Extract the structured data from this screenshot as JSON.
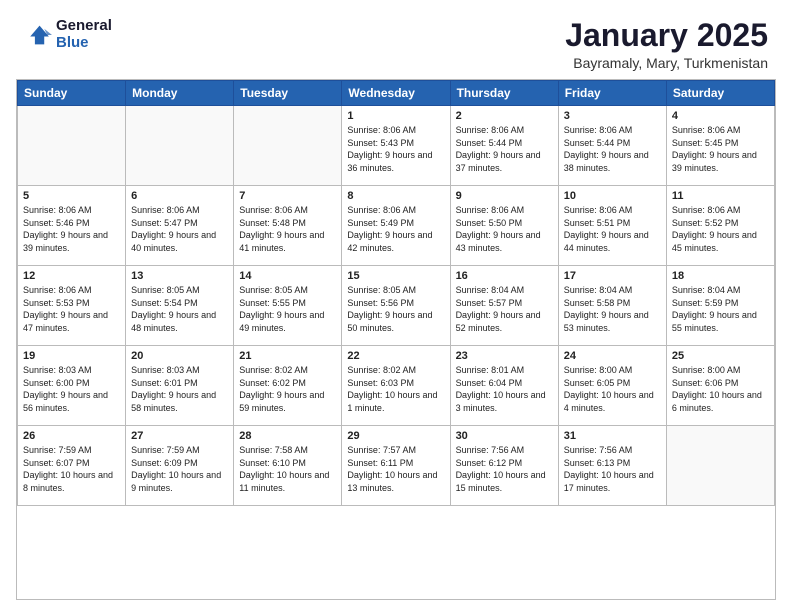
{
  "logo": {
    "general": "General",
    "blue": "Blue"
  },
  "title": "January 2025",
  "subtitle": "Bayramaly, Mary, Turkmenistan",
  "headers": [
    "Sunday",
    "Monday",
    "Tuesday",
    "Wednesday",
    "Thursday",
    "Friday",
    "Saturday"
  ],
  "weeks": [
    [
      {
        "day": "",
        "empty": true
      },
      {
        "day": "",
        "empty": true
      },
      {
        "day": "",
        "empty": true
      },
      {
        "day": "1",
        "sunrise": "8:06 AM",
        "sunset": "5:43 PM",
        "daylight": "9 hours and 36 minutes."
      },
      {
        "day": "2",
        "sunrise": "8:06 AM",
        "sunset": "5:44 PM",
        "daylight": "9 hours and 37 minutes."
      },
      {
        "day": "3",
        "sunrise": "8:06 AM",
        "sunset": "5:44 PM",
        "daylight": "9 hours and 38 minutes."
      },
      {
        "day": "4",
        "sunrise": "8:06 AM",
        "sunset": "5:45 PM",
        "daylight": "9 hours and 39 minutes."
      }
    ],
    [
      {
        "day": "5",
        "sunrise": "8:06 AM",
        "sunset": "5:46 PM",
        "daylight": "9 hours and 39 minutes."
      },
      {
        "day": "6",
        "sunrise": "8:06 AM",
        "sunset": "5:47 PM",
        "daylight": "9 hours and 40 minutes."
      },
      {
        "day": "7",
        "sunrise": "8:06 AM",
        "sunset": "5:48 PM",
        "daylight": "9 hours and 41 minutes."
      },
      {
        "day": "8",
        "sunrise": "8:06 AM",
        "sunset": "5:49 PM",
        "daylight": "9 hours and 42 minutes."
      },
      {
        "day": "9",
        "sunrise": "8:06 AM",
        "sunset": "5:50 PM",
        "daylight": "9 hours and 43 minutes."
      },
      {
        "day": "10",
        "sunrise": "8:06 AM",
        "sunset": "5:51 PM",
        "daylight": "9 hours and 44 minutes."
      },
      {
        "day": "11",
        "sunrise": "8:06 AM",
        "sunset": "5:52 PM",
        "daylight": "9 hours and 45 minutes."
      }
    ],
    [
      {
        "day": "12",
        "sunrise": "8:06 AM",
        "sunset": "5:53 PM",
        "daylight": "9 hours and 47 minutes."
      },
      {
        "day": "13",
        "sunrise": "8:05 AM",
        "sunset": "5:54 PM",
        "daylight": "9 hours and 48 minutes."
      },
      {
        "day": "14",
        "sunrise": "8:05 AM",
        "sunset": "5:55 PM",
        "daylight": "9 hours and 49 minutes."
      },
      {
        "day": "15",
        "sunrise": "8:05 AM",
        "sunset": "5:56 PM",
        "daylight": "9 hours and 50 minutes."
      },
      {
        "day": "16",
        "sunrise": "8:04 AM",
        "sunset": "5:57 PM",
        "daylight": "9 hours and 52 minutes."
      },
      {
        "day": "17",
        "sunrise": "8:04 AM",
        "sunset": "5:58 PM",
        "daylight": "9 hours and 53 minutes."
      },
      {
        "day": "18",
        "sunrise": "8:04 AM",
        "sunset": "5:59 PM",
        "daylight": "9 hours and 55 minutes."
      }
    ],
    [
      {
        "day": "19",
        "sunrise": "8:03 AM",
        "sunset": "6:00 PM",
        "daylight": "9 hours and 56 minutes."
      },
      {
        "day": "20",
        "sunrise": "8:03 AM",
        "sunset": "6:01 PM",
        "daylight": "9 hours and 58 minutes."
      },
      {
        "day": "21",
        "sunrise": "8:02 AM",
        "sunset": "6:02 PM",
        "daylight": "9 hours and 59 minutes."
      },
      {
        "day": "22",
        "sunrise": "8:02 AM",
        "sunset": "6:03 PM",
        "daylight": "10 hours and 1 minute."
      },
      {
        "day": "23",
        "sunrise": "8:01 AM",
        "sunset": "6:04 PM",
        "daylight": "10 hours and 3 minutes."
      },
      {
        "day": "24",
        "sunrise": "8:00 AM",
        "sunset": "6:05 PM",
        "daylight": "10 hours and 4 minutes."
      },
      {
        "day": "25",
        "sunrise": "8:00 AM",
        "sunset": "6:06 PM",
        "daylight": "10 hours and 6 minutes."
      }
    ],
    [
      {
        "day": "26",
        "sunrise": "7:59 AM",
        "sunset": "6:07 PM",
        "daylight": "10 hours and 8 minutes."
      },
      {
        "day": "27",
        "sunrise": "7:59 AM",
        "sunset": "6:09 PM",
        "daylight": "10 hours and 9 minutes."
      },
      {
        "day": "28",
        "sunrise": "7:58 AM",
        "sunset": "6:10 PM",
        "daylight": "10 hours and 11 minutes."
      },
      {
        "day": "29",
        "sunrise": "7:57 AM",
        "sunset": "6:11 PM",
        "daylight": "10 hours and 13 minutes."
      },
      {
        "day": "30",
        "sunrise": "7:56 AM",
        "sunset": "6:12 PM",
        "daylight": "10 hours and 15 minutes."
      },
      {
        "day": "31",
        "sunrise": "7:56 AM",
        "sunset": "6:13 PM",
        "daylight": "10 hours and 17 minutes."
      },
      {
        "day": "",
        "empty": true
      }
    ]
  ]
}
